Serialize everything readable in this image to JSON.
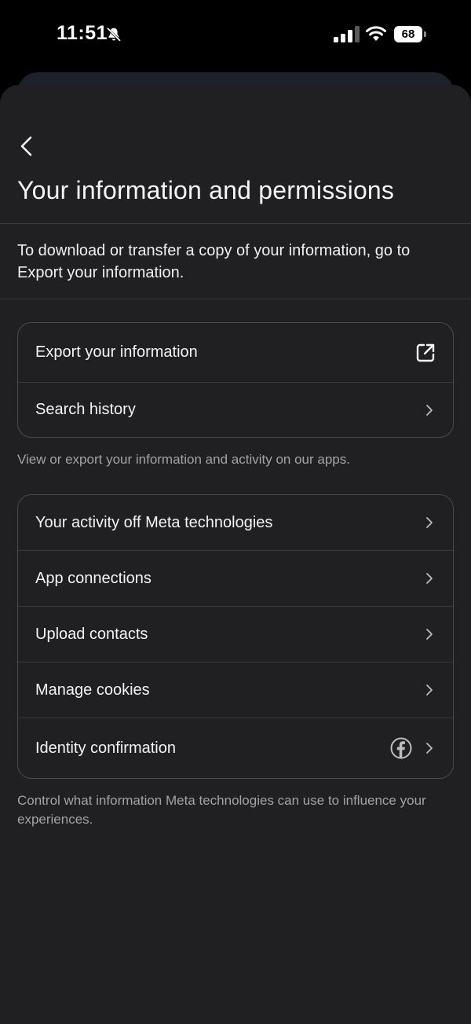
{
  "status_bar": {
    "time": "11:51",
    "battery": "68",
    "icons": [
      "bell-slash-icon",
      "signal-icon",
      "wifi-icon",
      "battery-icon"
    ]
  },
  "header": {
    "title": "Your information and permissions",
    "back_icon": "chevron-left-icon"
  },
  "intro": {
    "text": "To download or transfer a copy of your information, go to Export your information."
  },
  "group1": {
    "items": [
      {
        "label": "Export your information",
        "icon": "external-link-icon"
      },
      {
        "label": "Search history",
        "icon": "chevron-right-icon"
      }
    ],
    "caption": "View or export your information and activity on our apps."
  },
  "group2": {
    "items": [
      {
        "label": "Your activity off Meta technologies",
        "icon": "chevron-right-icon"
      },
      {
        "label": "App connections",
        "icon": "chevron-right-icon"
      },
      {
        "label": "Upload contacts",
        "icon": "chevron-right-icon"
      },
      {
        "label": "Manage cookies",
        "icon": "chevron-right-icon"
      },
      {
        "label": "Identity confirmation",
        "icon": "chevron-right-icon",
        "extra_icon": "facebook-icon"
      }
    ],
    "caption": "Control what information Meta technologies can use to influence your experiences."
  },
  "colors": {
    "background": "#202022",
    "text": "#f5f5f5",
    "caption": "#a3a3a6",
    "border": "#4a4a4d"
  }
}
